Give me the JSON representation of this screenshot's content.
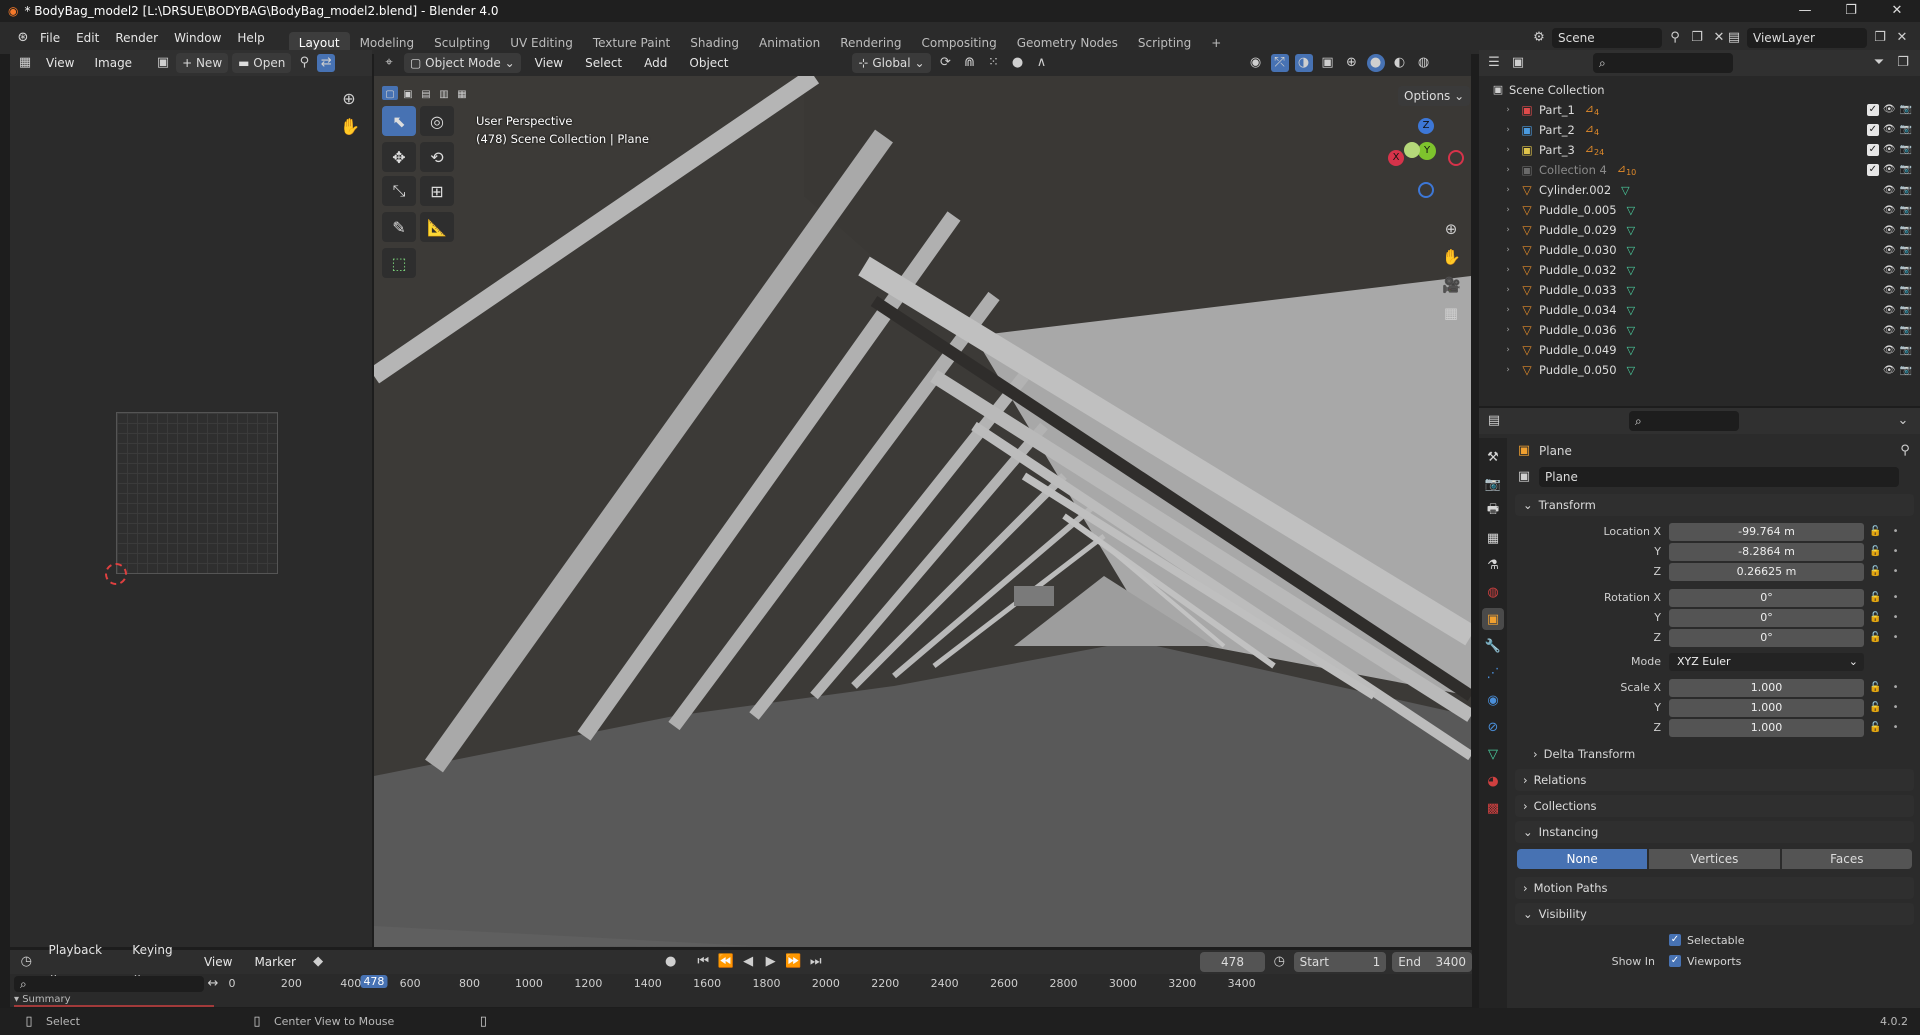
{
  "window": {
    "title": "* BodyBag_model2 [L:\\DRSUE\\BODYBAG\\BodyBag_model2.blend] - Blender 4.0",
    "controls": [
      "—",
      "❐",
      "✕"
    ]
  },
  "menu": [
    "File",
    "Edit",
    "Render",
    "Window",
    "Help"
  ],
  "workspaces": [
    "Layout",
    "Modeling",
    "Sculpting",
    "UV Editing",
    "Texture Paint",
    "Shading",
    "Animation",
    "Rendering",
    "Compositing",
    "Geometry Nodes",
    "Scripting"
  ],
  "active_workspace": "Layout",
  "scene": {
    "name": "Scene",
    "view_layer": "ViewLayer"
  },
  "image_editor": {
    "menus": [
      "View",
      "Image"
    ],
    "new_label": "New",
    "open_label": "Open"
  },
  "viewport": {
    "mode": "Object Mode",
    "menus": [
      "View",
      "Select",
      "Add",
      "Object"
    ],
    "orientation": "Global",
    "options_label": "Options",
    "overlay_line1": "User Perspective",
    "overlay_line2": "(478) Scene Collection | Plane",
    "gizmo_axes": {
      "z": "Z",
      "y": "Y",
      "x": "X"
    }
  },
  "outliner": {
    "root": "Scene Collection",
    "items": [
      {
        "name": "Part_1",
        "type": "collection",
        "color": "#e04b4b",
        "badge": "4"
      },
      {
        "name": "Part_2",
        "type": "collection",
        "color": "#4b9be0",
        "badge": "4"
      },
      {
        "name": "Part_3",
        "type": "collection",
        "color": "#e0c44b",
        "badge": "24"
      },
      {
        "name": "Collection 4",
        "type": "collection",
        "color": "#6a6a6a",
        "badge": "10",
        "dim": true
      },
      {
        "name": "Cylinder.002",
        "type": "mesh"
      },
      {
        "name": "Puddle_0.005",
        "type": "mesh"
      },
      {
        "name": "Puddle_0.029",
        "type": "mesh"
      },
      {
        "name": "Puddle_0.030",
        "type": "mesh"
      },
      {
        "name": "Puddle_0.032",
        "type": "mesh"
      },
      {
        "name": "Puddle_0.033",
        "type": "mesh"
      },
      {
        "name": "Puddle_0.034",
        "type": "mesh"
      },
      {
        "name": "Puddle_0.036",
        "type": "mesh"
      },
      {
        "name": "Puddle_0.049",
        "type": "mesh"
      },
      {
        "name": "Puddle_0.050",
        "type": "mesh"
      }
    ]
  },
  "properties": {
    "object_name": "Plane",
    "data_name": "Plane",
    "transform_label": "Transform",
    "location": {
      "label_x": "Location X",
      "label_y": "Y",
      "label_z": "Z",
      "x": "-99.764 m",
      "y": "-8.2864 m",
      "z": "0.26625 m"
    },
    "rotation": {
      "label_x": "Rotation X",
      "label_y": "Y",
      "label_z": "Z",
      "x": "0°",
      "y": "0°",
      "z": "0°"
    },
    "mode_label": "Mode",
    "mode_value": "XYZ Euler",
    "scale": {
      "label_x": "Scale X",
      "label_y": "Y",
      "label_z": "Z",
      "x": "1.000",
      "y": "1.000",
      "z": "1.000"
    },
    "delta_transform": "Delta Transform",
    "relations": "Relations",
    "collections": "Collections",
    "instancing": "Instancing",
    "instancing_options": [
      "None",
      "Vertices",
      "Faces"
    ],
    "instancing_active": "None",
    "motion_paths": "Motion Paths",
    "visibility": "Visibility",
    "selectable": "Selectable",
    "show_in_label": "Show In",
    "viewports": "Viewports"
  },
  "timeline": {
    "menus": [
      "Playback",
      "Keying",
      "View",
      "Marker"
    ],
    "current_frame": "478",
    "start_label": "Start",
    "start": "1",
    "end_label": "End",
    "end": "3400",
    "ruler": [
      "0",
      "200",
      "400",
      "600",
      "800",
      "1000",
      "1200",
      "1400",
      "1600",
      "1800",
      "2000",
      "2200",
      "2400",
      "2600",
      "2800",
      "3000",
      "3200",
      "3400"
    ],
    "playhead": "478",
    "summary": "Summary"
  },
  "statusbar": {
    "select": "Select",
    "center": "Center View to Mouse",
    "version": "4.0.2"
  },
  "colors": {
    "accent": "#4772b3",
    "mesh_icon": "#e08a2a",
    "vertex_icon": "#4bd0a0"
  }
}
